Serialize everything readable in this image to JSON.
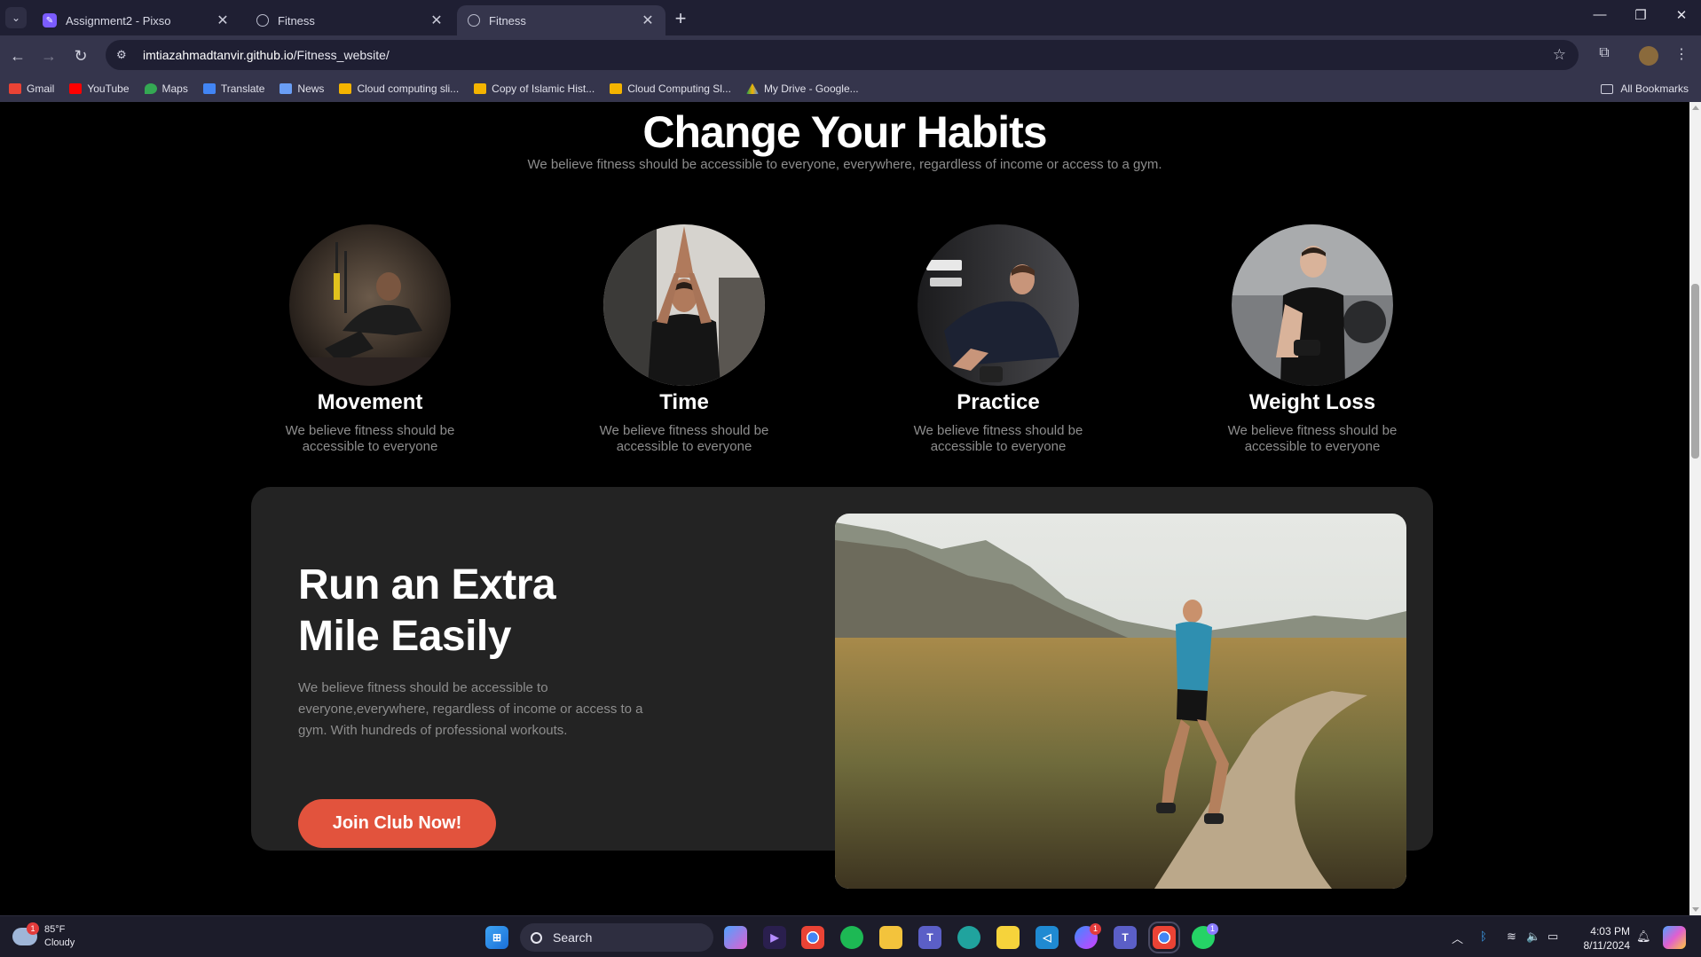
{
  "browser": {
    "tabs": [
      {
        "label": "Assignment2 - Pixso",
        "favicon": "pixso-icon"
      },
      {
        "label": "Fitness",
        "favicon": "globe-icon"
      },
      {
        "label": "Fitness",
        "favicon": "globe-icon",
        "active": true
      }
    ],
    "url_domain": "imtiazahmadtanvir.github.io",
    "url_path": "/Fitness_website/",
    "bookmarks": [
      {
        "label": "Gmail",
        "color": "#ea4335"
      },
      {
        "label": "YouTube",
        "color": "#ff0000"
      },
      {
        "label": "Maps",
        "color": "#34a853"
      },
      {
        "label": "Translate",
        "color": "#4285f4"
      },
      {
        "label": "News",
        "color": "#4285f4"
      },
      {
        "label": "Cloud computing sli...",
        "color": "#f4b400"
      },
      {
        "label": "Copy of Islamic Hist...",
        "color": "#f4b400"
      },
      {
        "label": "Cloud Computing Sl...",
        "color": "#f4b400"
      },
      {
        "label": "My Drive - Google...",
        "color": "#0f9d58"
      }
    ],
    "all_bookmarks": "All Bookmarks"
  },
  "page": {
    "hero": {
      "title": "Change Your Habits",
      "subtitle": "We believe fitness should be accessible to everyone, everywhere, regardless of income or access to a gym."
    },
    "features": [
      {
        "title": "Movement",
        "desc": "We believe fitness should be accessible to everyone"
      },
      {
        "title": "Time",
        "desc": "We believe fitness should be accessible to everyone"
      },
      {
        "title": "Practice",
        "desc": "We believe fitness should be accessible to everyone"
      },
      {
        "title": "Weight Loss",
        "desc": "We believe fitness should be accessible to everyone"
      }
    ],
    "promo": {
      "title_line1": "Run an Extra",
      "title_line2": "Mile Easily",
      "desc": "We believe fitness should be accessible to everyone,everywhere, regardless of income or access to a gym. With hundreds of professional workouts.",
      "cta": "Join Club Now!",
      "cta_color": "#e2533d"
    }
  },
  "taskbar": {
    "weather_temp": "85°F",
    "weather_cond": "Cloudy",
    "weather_badge": "1",
    "search_label": "Search",
    "time": "4:03 PM",
    "date": "8/11/2024",
    "messenger_badge": "1",
    "whatsapp_badge": "1"
  }
}
